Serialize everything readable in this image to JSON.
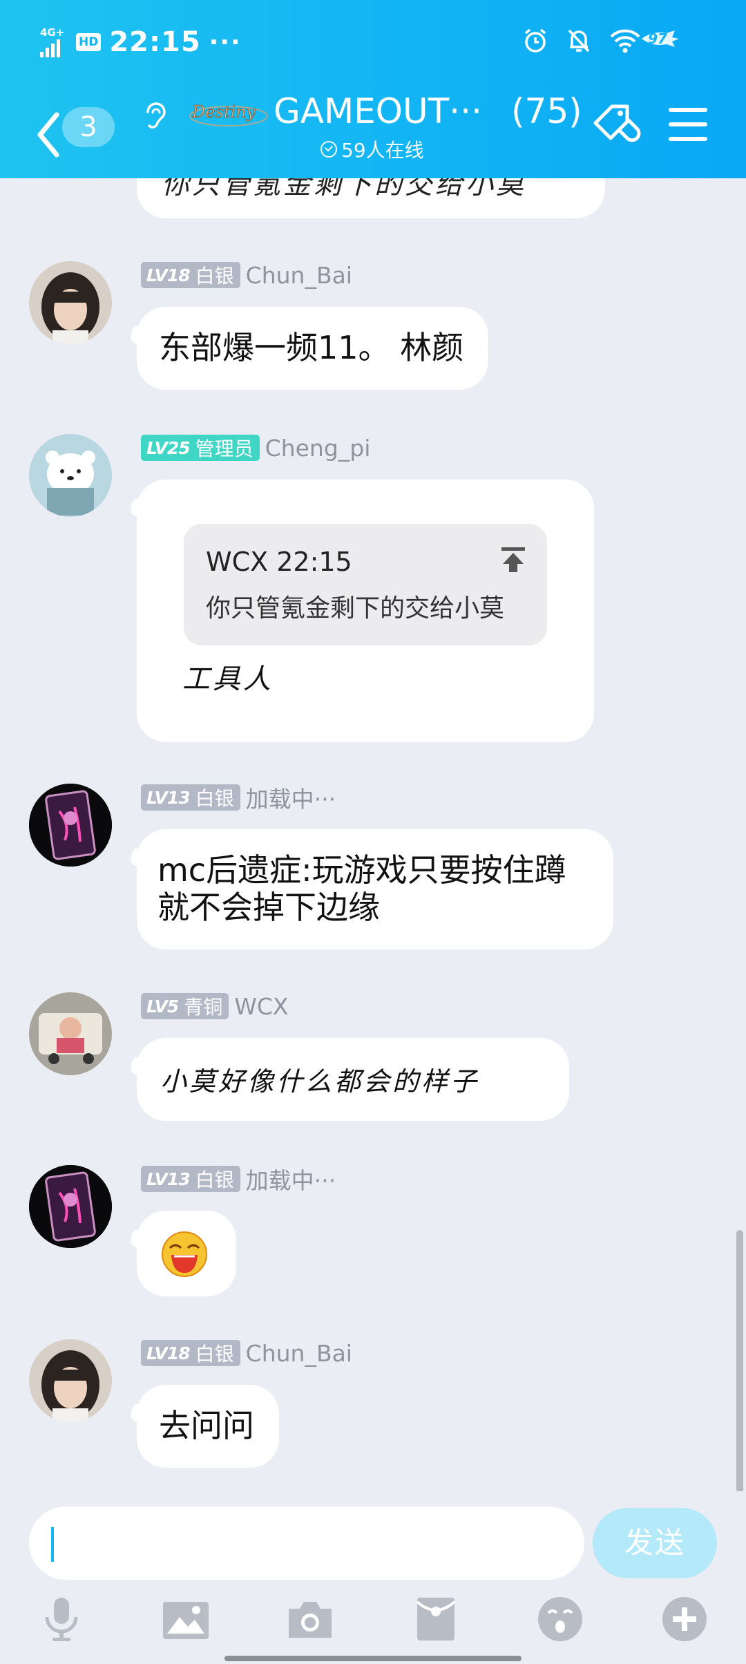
{
  "status_bar": {
    "network": "4G+",
    "hd": "HD",
    "time": "22:15",
    "more": "···",
    "battery": "97"
  },
  "header": {
    "unread_count": "3",
    "logo_text": "Destiny",
    "group_name": "GAMEOUT···",
    "member_count": "(75)",
    "online_status": "59人在线"
  },
  "messages": [
    {
      "partial_text": "你只管氪金剩下的交给小莫"
    },
    {
      "level": "LV18",
      "rank": "白银",
      "username": "Chun_Bai",
      "text": "东部爆一频11。 林颜"
    },
    {
      "level": "LV25",
      "rank": "管理员",
      "username": "Cheng_pi",
      "quote_header": "WCX 22:15",
      "quote_text": "你只管氪金剩下的交给小莫",
      "text": "工具人"
    },
    {
      "level": "LV13",
      "rank": "白银",
      "username": "加载中···",
      "text": "mc后遗症:玩游戏只要按住蹲就不会掉下边缘"
    },
    {
      "level": "LV5",
      "rank": "青铜",
      "username": "WCX",
      "text": "小莫好像什么都会的样子"
    },
    {
      "level": "LV13",
      "rank": "白银",
      "username": "加载中···",
      "sticker": "laughing-emoji"
    },
    {
      "level": "LV18",
      "rank": "白银",
      "username": "Chun_Bai",
      "text": "去问问"
    }
  ],
  "composer": {
    "input_value": "",
    "send_label": "发送",
    "tools": [
      "microphone-icon",
      "image-icon",
      "camera-icon",
      "red-envelope-icon",
      "emoji-icon",
      "plus-icon"
    ]
  },
  "colors": {
    "header_start": "#1fc3f0",
    "header_end": "#0aa8f5",
    "admin_badge": "#3fd6c5",
    "silver_badge": "#b3b8c6",
    "send_disabled": "#b4e9f9",
    "chat_background": "#eaedf3"
  }
}
